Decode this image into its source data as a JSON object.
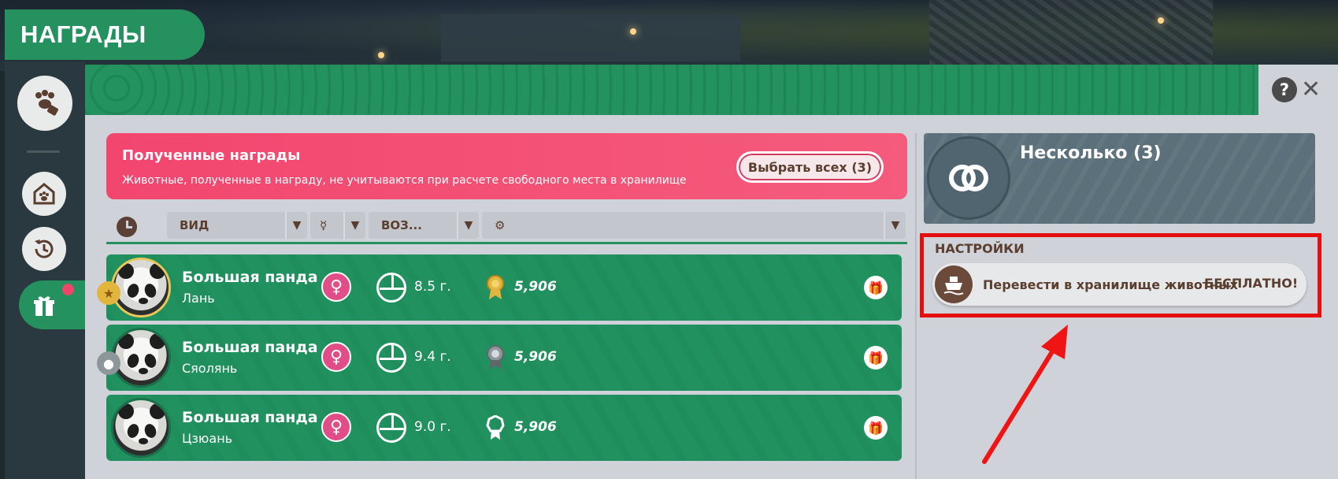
{
  "window": {
    "title": "НАГРАДЫ"
  },
  "sidebar": {
    "items": [
      {
        "name": "animals",
        "icon": "paw-tag-icon"
      },
      {
        "name": "habitat",
        "icon": "house-paw-icon"
      },
      {
        "name": "history",
        "icon": "history-icon"
      },
      {
        "name": "rewards",
        "icon": "gift-icon",
        "active": true,
        "notification": true
      }
    ]
  },
  "banner": {
    "title": "Полученные награды",
    "subtitle": "Животные, полученные в награду, не учитываются при расчете свободного места в хранилище",
    "select_all": "Выбрать всех (3)"
  },
  "filters": {
    "species": "ВИД",
    "age": "ВОЗ..."
  },
  "rows": [
    {
      "species": "Большая панда",
      "name": "Лань",
      "sex": "♀",
      "age": "8.5 г.",
      "award_tier": "gold",
      "award_value": "5,906"
    },
    {
      "species": "Большая панда",
      "name": "Сяолянь",
      "sex": "♀",
      "age": "9.4 г.",
      "award_tier": "silver",
      "award_value": "5,906"
    },
    {
      "species": "Большая панда",
      "name": "Цзюань",
      "sex": "♀",
      "age": "9.0 г.",
      "award_tier": "plain",
      "award_value": "5,906"
    }
  ],
  "selection": {
    "title": "Несколько (3)"
  },
  "settings": {
    "label": "НАСТРОЙКИ",
    "transfer_label": "Перевести в хранилище животных",
    "transfer_cost": "БЕСПЛАТНО!"
  },
  "colors": {
    "primary_green": "#24915f",
    "banner_pink": "#f2466f",
    "female_pink": "#e14d86",
    "highlight_red": "#e60f10",
    "text_brown": "#5a3e2f"
  }
}
